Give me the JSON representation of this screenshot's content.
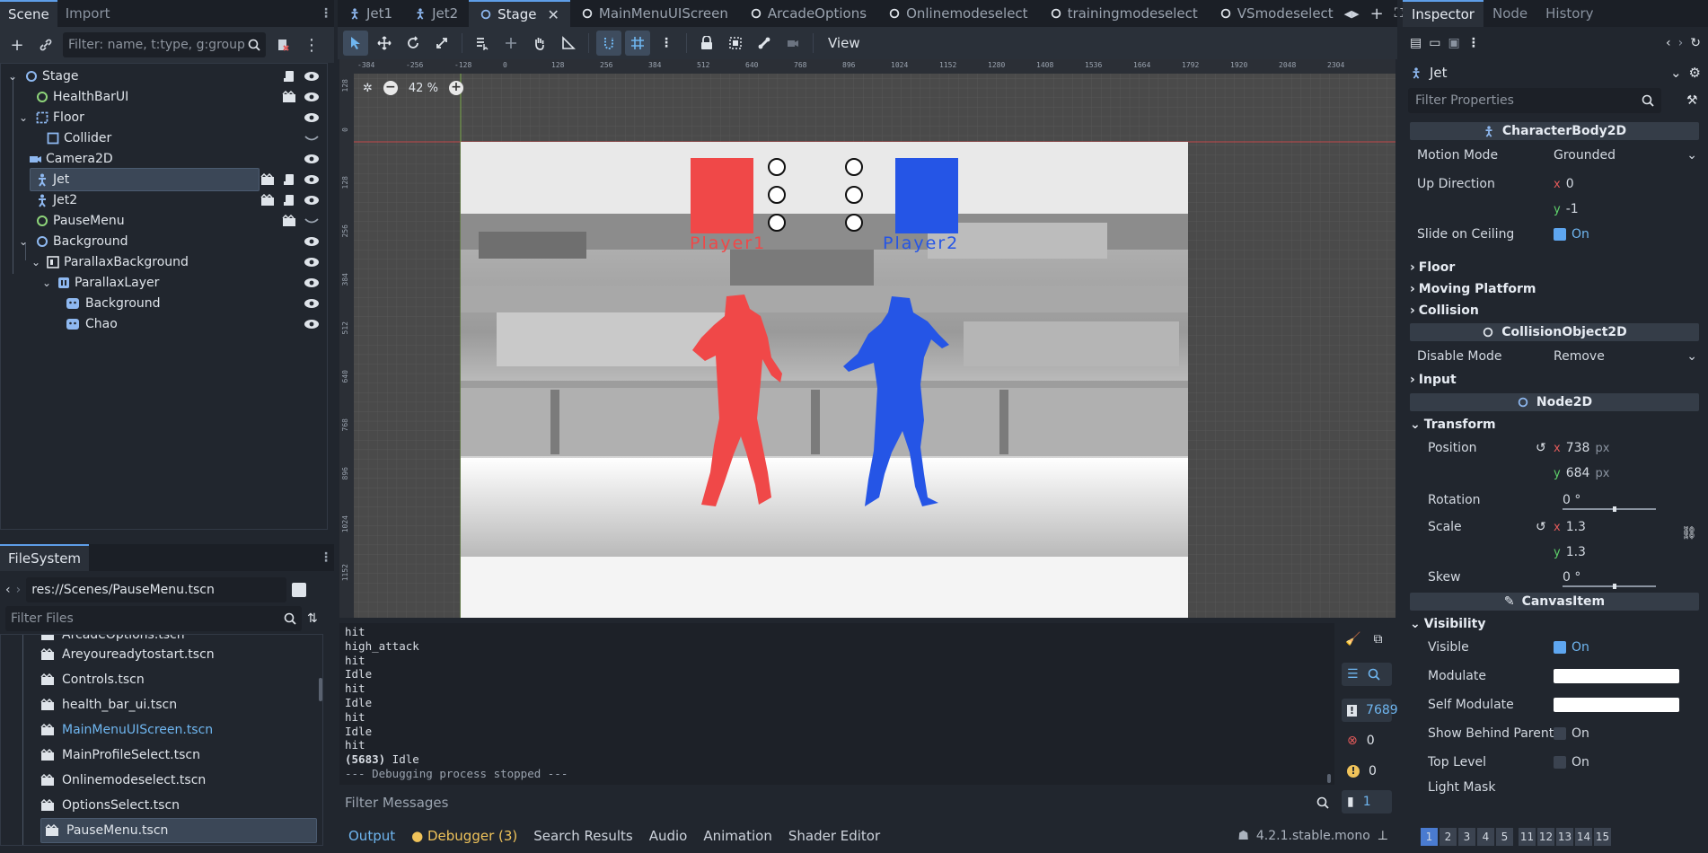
{
  "left_dock": {
    "tabs": [
      "Scene",
      "Import"
    ],
    "filter_placeholder": "Filter: name, t:type, g:group",
    "tree": [
      {
        "label": "Stage"
      },
      {
        "label": "HealthBarUI"
      },
      {
        "label": "Floor"
      },
      {
        "label": "Collider"
      },
      {
        "label": "Camera2D"
      },
      {
        "label": "Jet"
      },
      {
        "label": "Jet2"
      },
      {
        "label": "PauseMenu"
      },
      {
        "label": "Background"
      },
      {
        "label": "ParallaxBackground"
      },
      {
        "label": "ParallaxLayer"
      },
      {
        "label": "Background"
      },
      {
        "label": "Chao"
      }
    ],
    "fs_tab": "FileSystem",
    "fs_path": "res://Scenes/PauseMenu.tscn",
    "fs_filter_placeholder": "Filter Files",
    "files": [
      "ArcadeOptions.tscn",
      "Areyoureadytostart.tscn",
      "Controls.tscn",
      "health_bar_ui.tscn",
      "MainMenuUIScreen.tscn",
      "MainProfileSelect.tscn",
      "Onlinemodeselect.tscn",
      "OptionsSelect.tscn",
      "PauseMenu.tscn"
    ]
  },
  "editor_tabs": [
    "Jet1",
    "Jet2",
    "Stage",
    "MainMenuUIScreen",
    "ArcadeOptions",
    "Onlinemodeselect",
    "trainingmodeselect",
    "VSmodeselect"
  ],
  "toolbar": {
    "view_label": "View"
  },
  "viewport": {
    "zoom": "42 %",
    "ruler_h": [
      "-384",
      "-256",
      "-128",
      "0",
      "128",
      "256",
      "384",
      "512",
      "640",
      "768",
      "896",
      "1024",
      "1152",
      "1280",
      "1408",
      "1536",
      "1664",
      "1792",
      "1920",
      "2048",
      "2304"
    ],
    "ruler_v": [
      "128",
      "0",
      "128",
      "256",
      "384",
      "512",
      "640",
      "768",
      "896",
      "1024",
      "1152"
    ],
    "player1": "Player1",
    "player2": "Player2",
    "colors": {
      "p1": "#f04848",
      "p2": "#2555e6"
    }
  },
  "output": {
    "lines": [
      "hit",
      "high_attack",
      "hit",
      "Idle",
      "hit",
      "Idle",
      "hit",
      "Idle",
      "hit"
    ],
    "count_line_num": "(5683)",
    "count_line_text": " Idle",
    "stopped": "--- Debugging process stopped ---",
    "filter_placeholder": "Filter Messages",
    "counts": {
      "messages": "7689",
      "errors": "0",
      "warnings": "0",
      "other": "1"
    }
  },
  "bottom_tabs": [
    "Output",
    "Debugger (3)",
    "Search Results",
    "Audio",
    "Animation",
    "Shader Editor"
  ],
  "version": "4.2.1.stable.mono",
  "inspector": {
    "tabs": [
      "Inspector",
      "Node",
      "History"
    ],
    "object": "Jet",
    "filter_placeholder": "Filter Properties",
    "character_body": "CharacterBody2D",
    "motion_mode_label": "Motion Mode",
    "motion_mode": "Grounded",
    "up_direction_label": "Up Direction",
    "up_x": "0",
    "up_y": "-1",
    "slide_label": "Slide on Ceiling",
    "on": "On",
    "floor": "Floor",
    "moving_platform": "Moving Platform",
    "collision": "Collision",
    "collision_object": "CollisionObject2D",
    "disable_mode_label": "Disable Mode",
    "disable_mode": "Remove",
    "input": "Input",
    "node2d": "Node2D",
    "transform": "Transform",
    "position_label": "Position",
    "pos_x": "738",
    "pos_y": "684",
    "px": "px",
    "rotation_label": "Rotation",
    "rotation": "0 °",
    "scale_label": "Scale",
    "scale_x": "1.3",
    "scale_y": "1.3",
    "skew_label": "Skew",
    "skew": "0 °",
    "canvas_item": "CanvasItem",
    "visibility": "Visibility",
    "visible_label": "Visible",
    "modulate_label": "Modulate",
    "self_modulate_label": "Self Modulate",
    "show_behind_label": "Show Behind Parent",
    "top_level_label": "Top Level",
    "light_mask_label": "Light Mask",
    "layers": [
      "1",
      "2",
      "3",
      "4",
      "5",
      "11",
      "12",
      "13",
      "14",
      "15"
    ]
  }
}
